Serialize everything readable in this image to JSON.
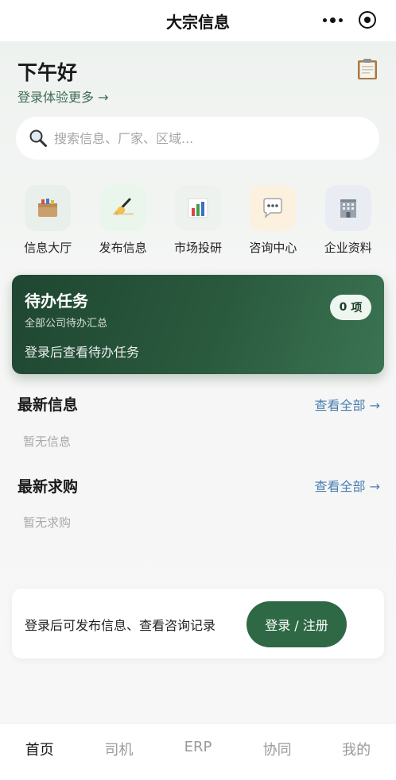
{
  "navbar": {
    "title": "大宗信息"
  },
  "header": {
    "greeting": "下午好",
    "login_link": "登录体验更多 →",
    "clipboard_icon": "clipboard-icon"
  },
  "search": {
    "placeholder": "搜索信息、厂家、区域...",
    "icon": "search-icon"
  },
  "quick_entries": [
    {
      "label": "信息大厅",
      "icon": "box-icon",
      "bg": "#e9efeb"
    },
    {
      "label": "发布信息",
      "icon": "writing-hand-icon",
      "bg": "#eaf6ec"
    },
    {
      "label": "市场投研",
      "icon": "bar-chart-icon",
      "bg": "#eef2ef"
    },
    {
      "label": "咨询中心",
      "icon": "speech-bubble-icon",
      "bg": "#fbf1de"
    },
    {
      "label": "企业资料",
      "icon": "office-building-icon",
      "bg": "#e9edf3"
    }
  ],
  "todo": {
    "title": "待办任务",
    "subtitle": "全部公司待办汇总",
    "hint": "登录后查看待办任务",
    "count": "0",
    "unit": "项"
  },
  "latest_info": {
    "title": "最新信息",
    "more": "查看全部 →",
    "empty": "暂无信息"
  },
  "latest_purchase": {
    "title": "最新求购",
    "more": "查看全部 →",
    "empty": "暂无求购"
  },
  "cta": {
    "text": "登录后可发布信息、查看咨询记录",
    "button": "登录 / 注册"
  },
  "tabbar": [
    {
      "label": "首页",
      "active": true
    },
    {
      "label": "司机",
      "active": false
    },
    {
      "label": "ERP",
      "active": false
    },
    {
      "label": "协同",
      "active": false
    },
    {
      "label": "我的",
      "active": false
    }
  ],
  "colors": {
    "accent": "#2f6845",
    "link": "#4a7fb0",
    "card_dark": "#1f4631"
  }
}
